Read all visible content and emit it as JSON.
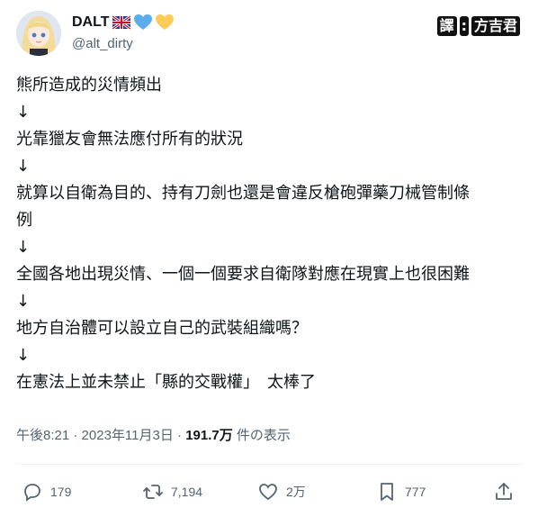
{
  "author": {
    "display_name": "DALT",
    "handle": "@alt_dirty",
    "badge_icons": [
      "uk-flag-icon",
      "blue-heart-icon",
      "yellow-heart-icon"
    ]
  },
  "translator": {
    "label": "譯",
    "colon": ":",
    "name": "方吉君"
  },
  "tweet": {
    "lines": [
      "熊所造成的災情頻出",
      "↓",
      "光靠獵友會無法應付所有的狀況",
      "↓",
      "就算以自衛為目的、持有刀劍也還是會違反槍砲彈藥刀械管制條",
      "例",
      "↓",
      "全國各地出現災情、一個一個要求自衛隊對應在現實上也很困難",
      "↓",
      "地方自治體可以設立自己的武裝組織嗎？",
      "↓",
      "在憲法上並未禁止「縣的交戰權」　太棒了"
    ]
  },
  "meta": {
    "time": "午後8:21",
    "separator": "·",
    "date": "2023年11月3日",
    "views": "191.7万",
    "views_label": "件の表示"
  },
  "actions": {
    "reply_count": "179",
    "retweet_count": "7,194",
    "like_count": "2万",
    "bookmark_count": "777"
  },
  "colors": {
    "text": "#0f1419",
    "secondary": "#536471",
    "divider": "#eff3f4"
  }
}
